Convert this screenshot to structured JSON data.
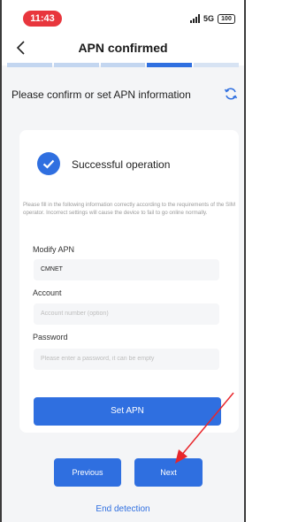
{
  "status_bar": {
    "time": "11:43",
    "network": "5G",
    "battery": "100"
  },
  "header": {
    "title": "APN confirmed"
  },
  "progress": {
    "steps_total": 5,
    "steps_done": 3,
    "active_step": 4
  },
  "section": {
    "title": "Please confirm or set APN information"
  },
  "card": {
    "success_text": "Successful operation",
    "notice": "Please fill in the following information correctly according to the requirements of the SIM operator. Incorrect settings will cause the device to fail to go online normally.",
    "apn": {
      "label": "Modify APN",
      "value": "CMNET"
    },
    "account": {
      "label": "Account",
      "placeholder": "Account number (option)"
    },
    "password": {
      "label": "Password",
      "placeholder": "Please enter a password, it can be empty"
    },
    "set_button": "Set APN"
  },
  "footer": {
    "previous": "Previous",
    "next": "Next",
    "end": "End detection"
  },
  "colors": {
    "accent": "#2f6fe0",
    "time_pill": "#e8363d",
    "arrow": "#e8262b"
  }
}
